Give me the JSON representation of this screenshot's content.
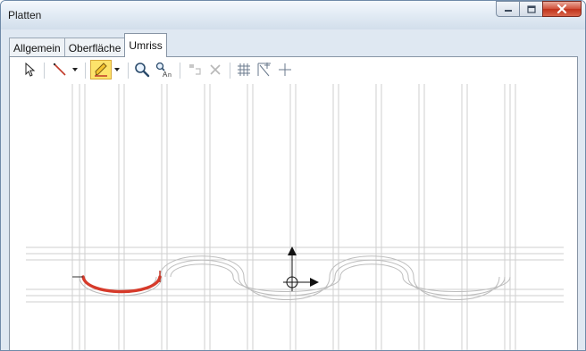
{
  "window": {
    "title": "Platten"
  },
  "caption_buttons": [
    {
      "icon": "minimize-icon"
    },
    {
      "icon": "maximize-icon"
    },
    {
      "icon": "close-icon"
    }
  ],
  "tabs": [
    {
      "label": "Allgemein",
      "active": false
    },
    {
      "label": "Oberfläche",
      "active": false
    },
    {
      "label": "Umriss",
      "active": true
    }
  ],
  "toolbar": {
    "items": [
      {
        "name": "select-tool",
        "icon": "cursor-arrow-icon"
      },
      {
        "name": "line-tool",
        "icon": "line-icon"
      },
      {
        "name": "line-dropdown",
        "icon": "chevron-down-icon"
      },
      {
        "name": "draw-tool",
        "icon": "pencil-icon",
        "active": true
      },
      {
        "name": "draw-dropdown",
        "icon": "chevron-down-icon"
      },
      {
        "name": "zoom-tool",
        "icon": "magnifier-icon"
      },
      {
        "name": "find-tool",
        "icon": "find-replace-icon"
      },
      {
        "name": "move-tool",
        "icon": "move-segment-icon",
        "enabled": false
      },
      {
        "name": "delete-tool",
        "icon": "delete-x-icon",
        "enabled": false
      },
      {
        "name": "grid-toggle",
        "icon": "grid-icon"
      },
      {
        "name": "snap-toggle",
        "icon": "snap-angle-icon"
      },
      {
        "name": "crosshair-toggle",
        "icon": "crosshair-icon"
      }
    ]
  },
  "colors": {
    "selected_segment": "#d63a2a",
    "guide_lines": "#c8c8c8",
    "outline_path": "#bdbdbd",
    "active_tool_bg": "#fde36b"
  }
}
